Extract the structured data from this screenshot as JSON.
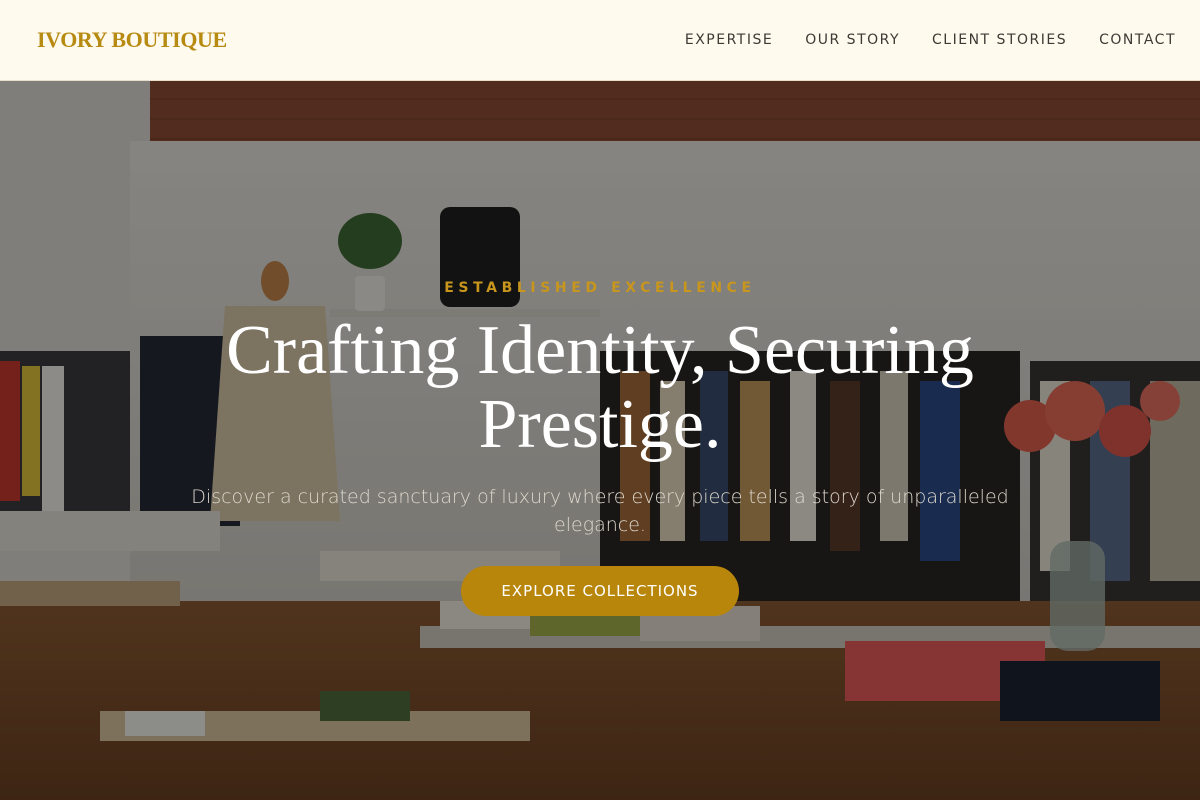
{
  "brand": {
    "logo_text": "IVORY BOUTIQUE",
    "accent_color": "#b8860b"
  },
  "nav": {
    "items": [
      {
        "label": "EXPERTISE"
      },
      {
        "label": "OUR STORY"
      },
      {
        "label": "CLIENT STORIES"
      },
      {
        "label": "CONTACT"
      }
    ]
  },
  "hero": {
    "eyebrow": "ESTABLISHED EXCELLENCE",
    "headline": "Crafting Identity, Securing Prestige.",
    "subtext": "Discover a curated sanctuary of luxury where every piece tells a story of unparalleled elegance.",
    "cta_label": "EXPLORE COLLECTIONS",
    "background": "boutique-interior-photo"
  }
}
